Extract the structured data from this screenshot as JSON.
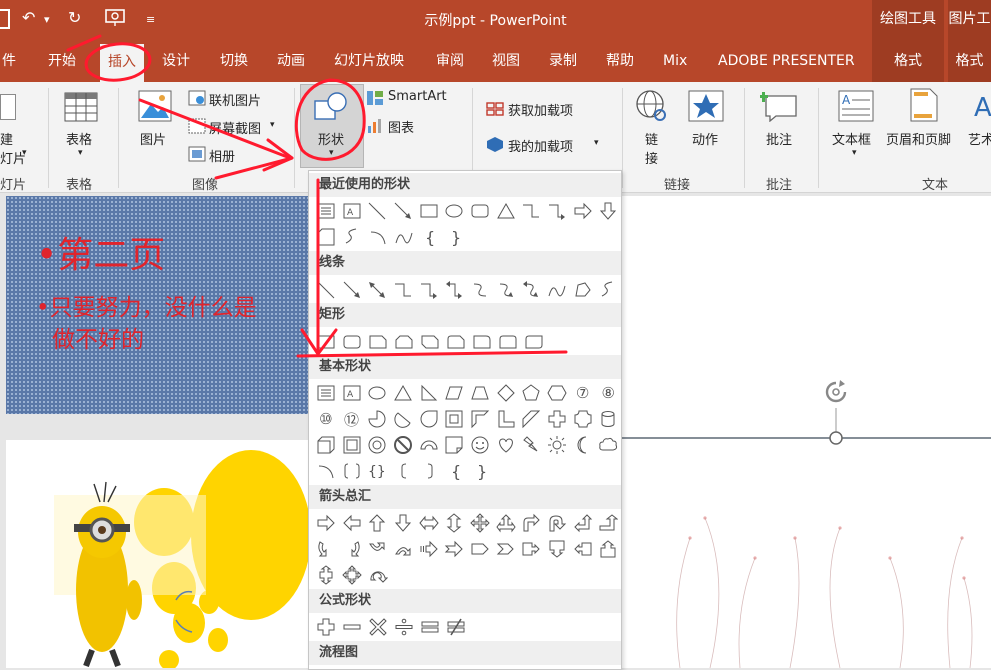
{
  "titlebar": {
    "doc_title": "示例ppt  -  PowerPoint",
    "context_header_1": "绘图工具",
    "context_header_2": "图片工"
  },
  "tabs": [
    {
      "label": "件"
    },
    {
      "label": "开始"
    },
    {
      "label": "插入"
    },
    {
      "label": "设计"
    },
    {
      "label": "切换"
    },
    {
      "label": "动画"
    },
    {
      "label": "幻灯片放映"
    },
    {
      "label": "审阅"
    },
    {
      "label": "视图"
    },
    {
      "label": "录制"
    },
    {
      "label": "帮助"
    },
    {
      "label": "Mix"
    },
    {
      "label": "ADOBE PRESENTER"
    }
  ],
  "context_tabs": [
    {
      "label": "格式"
    },
    {
      "label": "格式"
    }
  ],
  "ribbon": {
    "new_slide_line1": "建",
    "new_slide_line2": "灯片",
    "group_slides": "灯片",
    "table_label": "表格",
    "group_table": "表格",
    "picture_label": "图片",
    "online_pictures": "联机图片",
    "screenshot": "屏幕截图",
    "album": "相册",
    "group_images": "图像",
    "shapes_label": "形状",
    "smartart": "SmartArt",
    "chart": "图表",
    "get_addins": "获取加载项",
    "my_addins": "我的加载项",
    "link_line1": "链",
    "link_line2": "接",
    "action": "动作",
    "group_links": "链接",
    "comment": "批注",
    "group_comments": "批注",
    "textbox": "文本框",
    "header_footer": "页眉和页脚",
    "wordart": "艺术",
    "group_text": "文本"
  },
  "slide1": {
    "bullet1": "•第二页",
    "bullet2": "•只要努力，没什么是",
    "bullet2_cont": "做不好的"
  },
  "shapes_menu": {
    "sections": [
      {
        "title": "最近使用的形状"
      },
      {
        "title": "线条"
      },
      {
        "title": "矩形"
      },
      {
        "title": "基本形状"
      },
      {
        "title": "箭头总汇"
      },
      {
        "title": "公式形状"
      },
      {
        "title": "流程图"
      }
    ],
    "basic_num_labels": [
      "⑦",
      "⑧",
      "⑩",
      "⑫"
    ]
  },
  "colors": {
    "accent": "#b7472a",
    "accent_dark": "#9e3c22",
    "annotation_red": "#ff1a2e"
  }
}
